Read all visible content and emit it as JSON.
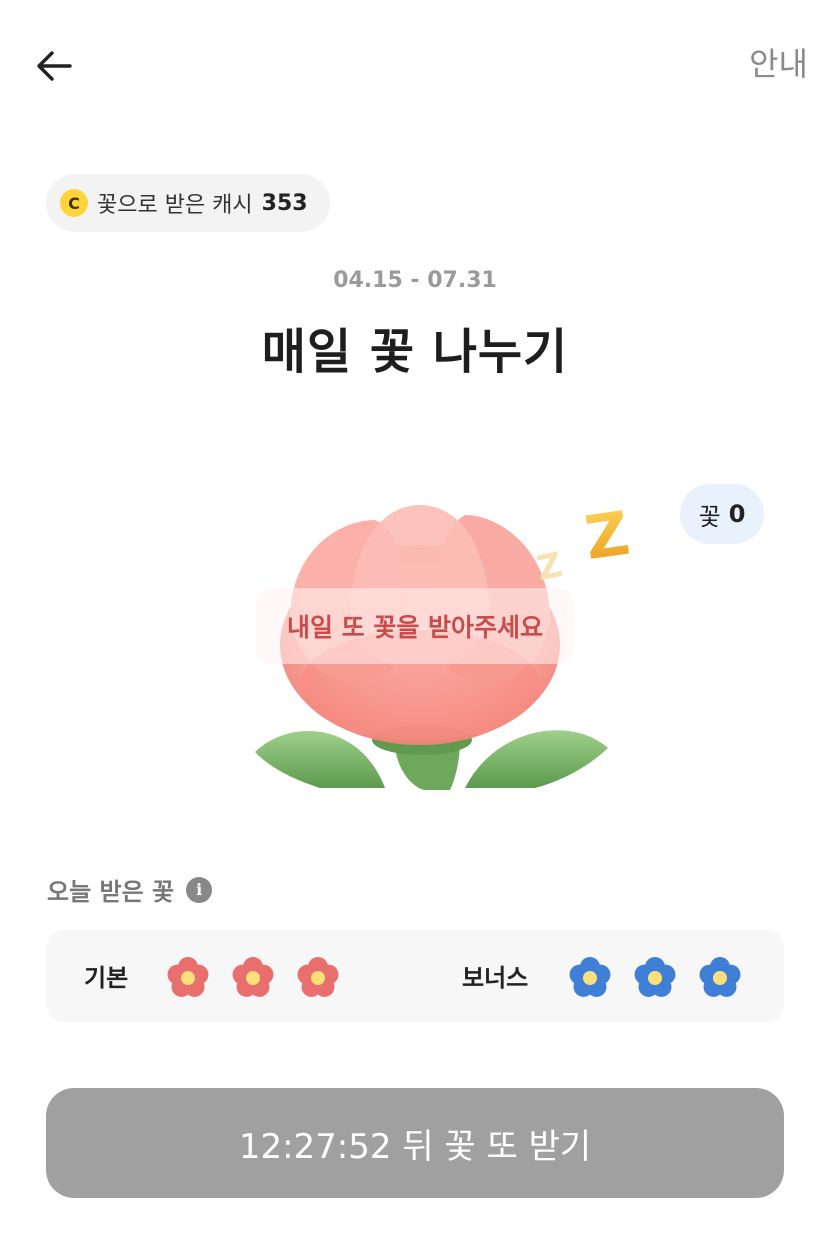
{
  "header": {
    "guide_label": "안내"
  },
  "cash": {
    "icon_letter": "C",
    "label": "꽃으로 받은 캐시",
    "amount": "353"
  },
  "event": {
    "period": "04.15 - 07.31",
    "title": "매일 꽃 나누기"
  },
  "illustration": {
    "flower_count_label": "꽃",
    "flower_count": "0",
    "message": "내일 또 꽃을 받아주세요",
    "sleep_letters": [
      "Z",
      "Z"
    ]
  },
  "today": {
    "label": "오늘 받은 꽃",
    "info_icon": "i",
    "basic_label": "기본",
    "basic_count": 3,
    "bonus_label": "보너스",
    "bonus_count": 3
  },
  "cta": {
    "label": "12:27:52 뒤 꽃 또 받기"
  },
  "colors": {
    "basic_flower": "#e96f6f",
    "bonus_flower": "#3f7fd6",
    "flower_center": "#fbe07a",
    "button_disabled": "#a0a0a0",
    "coin": "#ffd43b"
  }
}
